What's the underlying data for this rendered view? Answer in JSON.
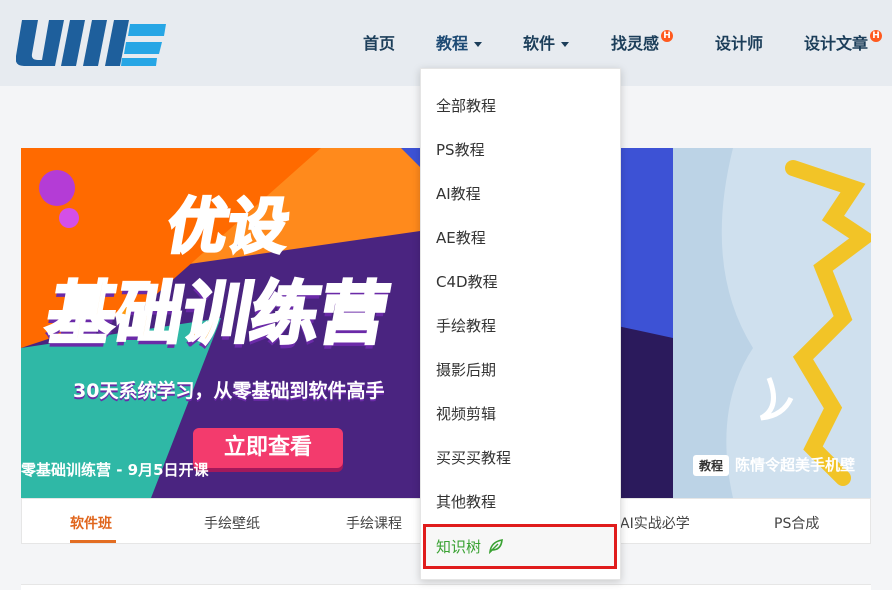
{
  "header": {
    "logo_text": "UIII",
    "nav": [
      {
        "label": "首页",
        "dropdown": false,
        "hot": false
      },
      {
        "label": "教程",
        "dropdown": true,
        "hot": false
      },
      {
        "label": "软件",
        "dropdown": true,
        "hot": false
      },
      {
        "label": "找灵感",
        "dropdown": false,
        "hot": true
      },
      {
        "label": "设计师",
        "dropdown": false,
        "hot": false
      },
      {
        "label": "设计文章",
        "dropdown": false,
        "hot": true
      }
    ],
    "hot_badge": "H"
  },
  "dropdown": {
    "items": [
      "全部教程",
      "PS教程",
      "AI教程",
      "AE教程",
      "C4D教程",
      "手绘教程",
      "摄影后期",
      "视频剪辑",
      "买买买教程",
      "其他教程",
      "知识树"
    ]
  },
  "banner": {
    "title_line1": "优设",
    "title_line2": "基础训练营",
    "slogan": "30天系统学习，从零基础到软件高手",
    "cta": "立即查看",
    "caption_left": "零基础训练营 - 9月5日开课",
    "caption_right_tag": "教程",
    "caption_right": "陈情令超美手机壁"
  },
  "tabs": [
    "软件班",
    "手绘壁纸",
    "手绘课程",
    "AI实战必学",
    "PS合成"
  ],
  "colors": {
    "accent_orange": "#e36d22",
    "highlight_red": "#e01c1c",
    "leaf_green": "#3aa233",
    "nav_text": "#1c3e5a",
    "logo_blue": "#1e6fb6"
  },
  "icons": {
    "hot": "hot-badge-icon",
    "leaf": "leaf-icon",
    "caret": "caret-down-icon"
  }
}
